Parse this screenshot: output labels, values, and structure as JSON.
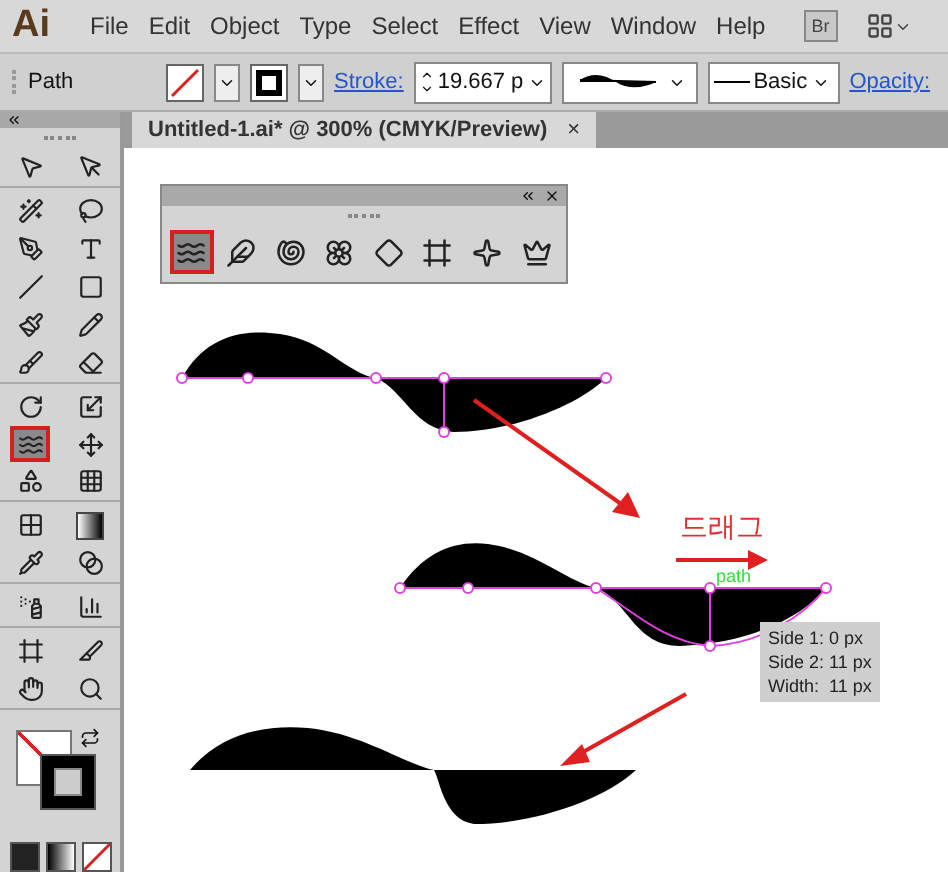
{
  "app": {
    "logo": "Ai",
    "menu": [
      "File",
      "Edit",
      "Object",
      "Type",
      "Select",
      "Effect",
      "View",
      "Window",
      "Help"
    ],
    "bridge_button": "Br"
  },
  "control_bar": {
    "selection_label": "Path",
    "stroke_label": "Stroke:",
    "stroke_weight": "19.667 p",
    "brush": "Basic",
    "opacity_label": "Opacity:"
  },
  "document_tab": {
    "title": "Untitled-1.ai* @ 300% (CMYK/Preview)",
    "close": "×"
  },
  "toolbox": {
    "tools": [
      {
        "selected": false
      },
      {
        "selected": false
      },
      {
        "selected": false
      },
      {
        "selected": false
      },
      {
        "selected": false
      },
      {
        "selected": false
      },
      {
        "selected": false
      },
      {
        "selected": false
      },
      {
        "selected": false
      },
      {
        "selected": false
      },
      {
        "selected": false
      },
      {
        "selected": false
      },
      {
        "selected": false
      },
      {
        "selected": false
      },
      {
        "selected": true
      },
      {
        "selected": false
      },
      {
        "selected": false
      },
      {
        "selected": false
      },
      {
        "selected": false
      },
      {
        "selected": false
      },
      {
        "selected": false
      },
      {
        "selected": false
      },
      {
        "selected": false
      },
      {
        "selected": false
      },
      {
        "selected": false
      },
      {
        "selected": false
      },
      {
        "selected": false
      },
      {
        "selected": false
      }
    ]
  },
  "width_tools_panel": {
    "tools": [
      {
        "selected": true
      },
      {
        "selected": false
      },
      {
        "selected": false
      },
      {
        "selected": false
      },
      {
        "selected": false
      },
      {
        "selected": false
      },
      {
        "selected": false
      },
      {
        "selected": false
      }
    ]
  },
  "canvas": {
    "drag_label": "드래그",
    "path_hint": "path",
    "width_tooltip": [
      "Side 1: 0 px",
      "Side 2: 11 px",
      "Width:  11 px"
    ]
  }
}
